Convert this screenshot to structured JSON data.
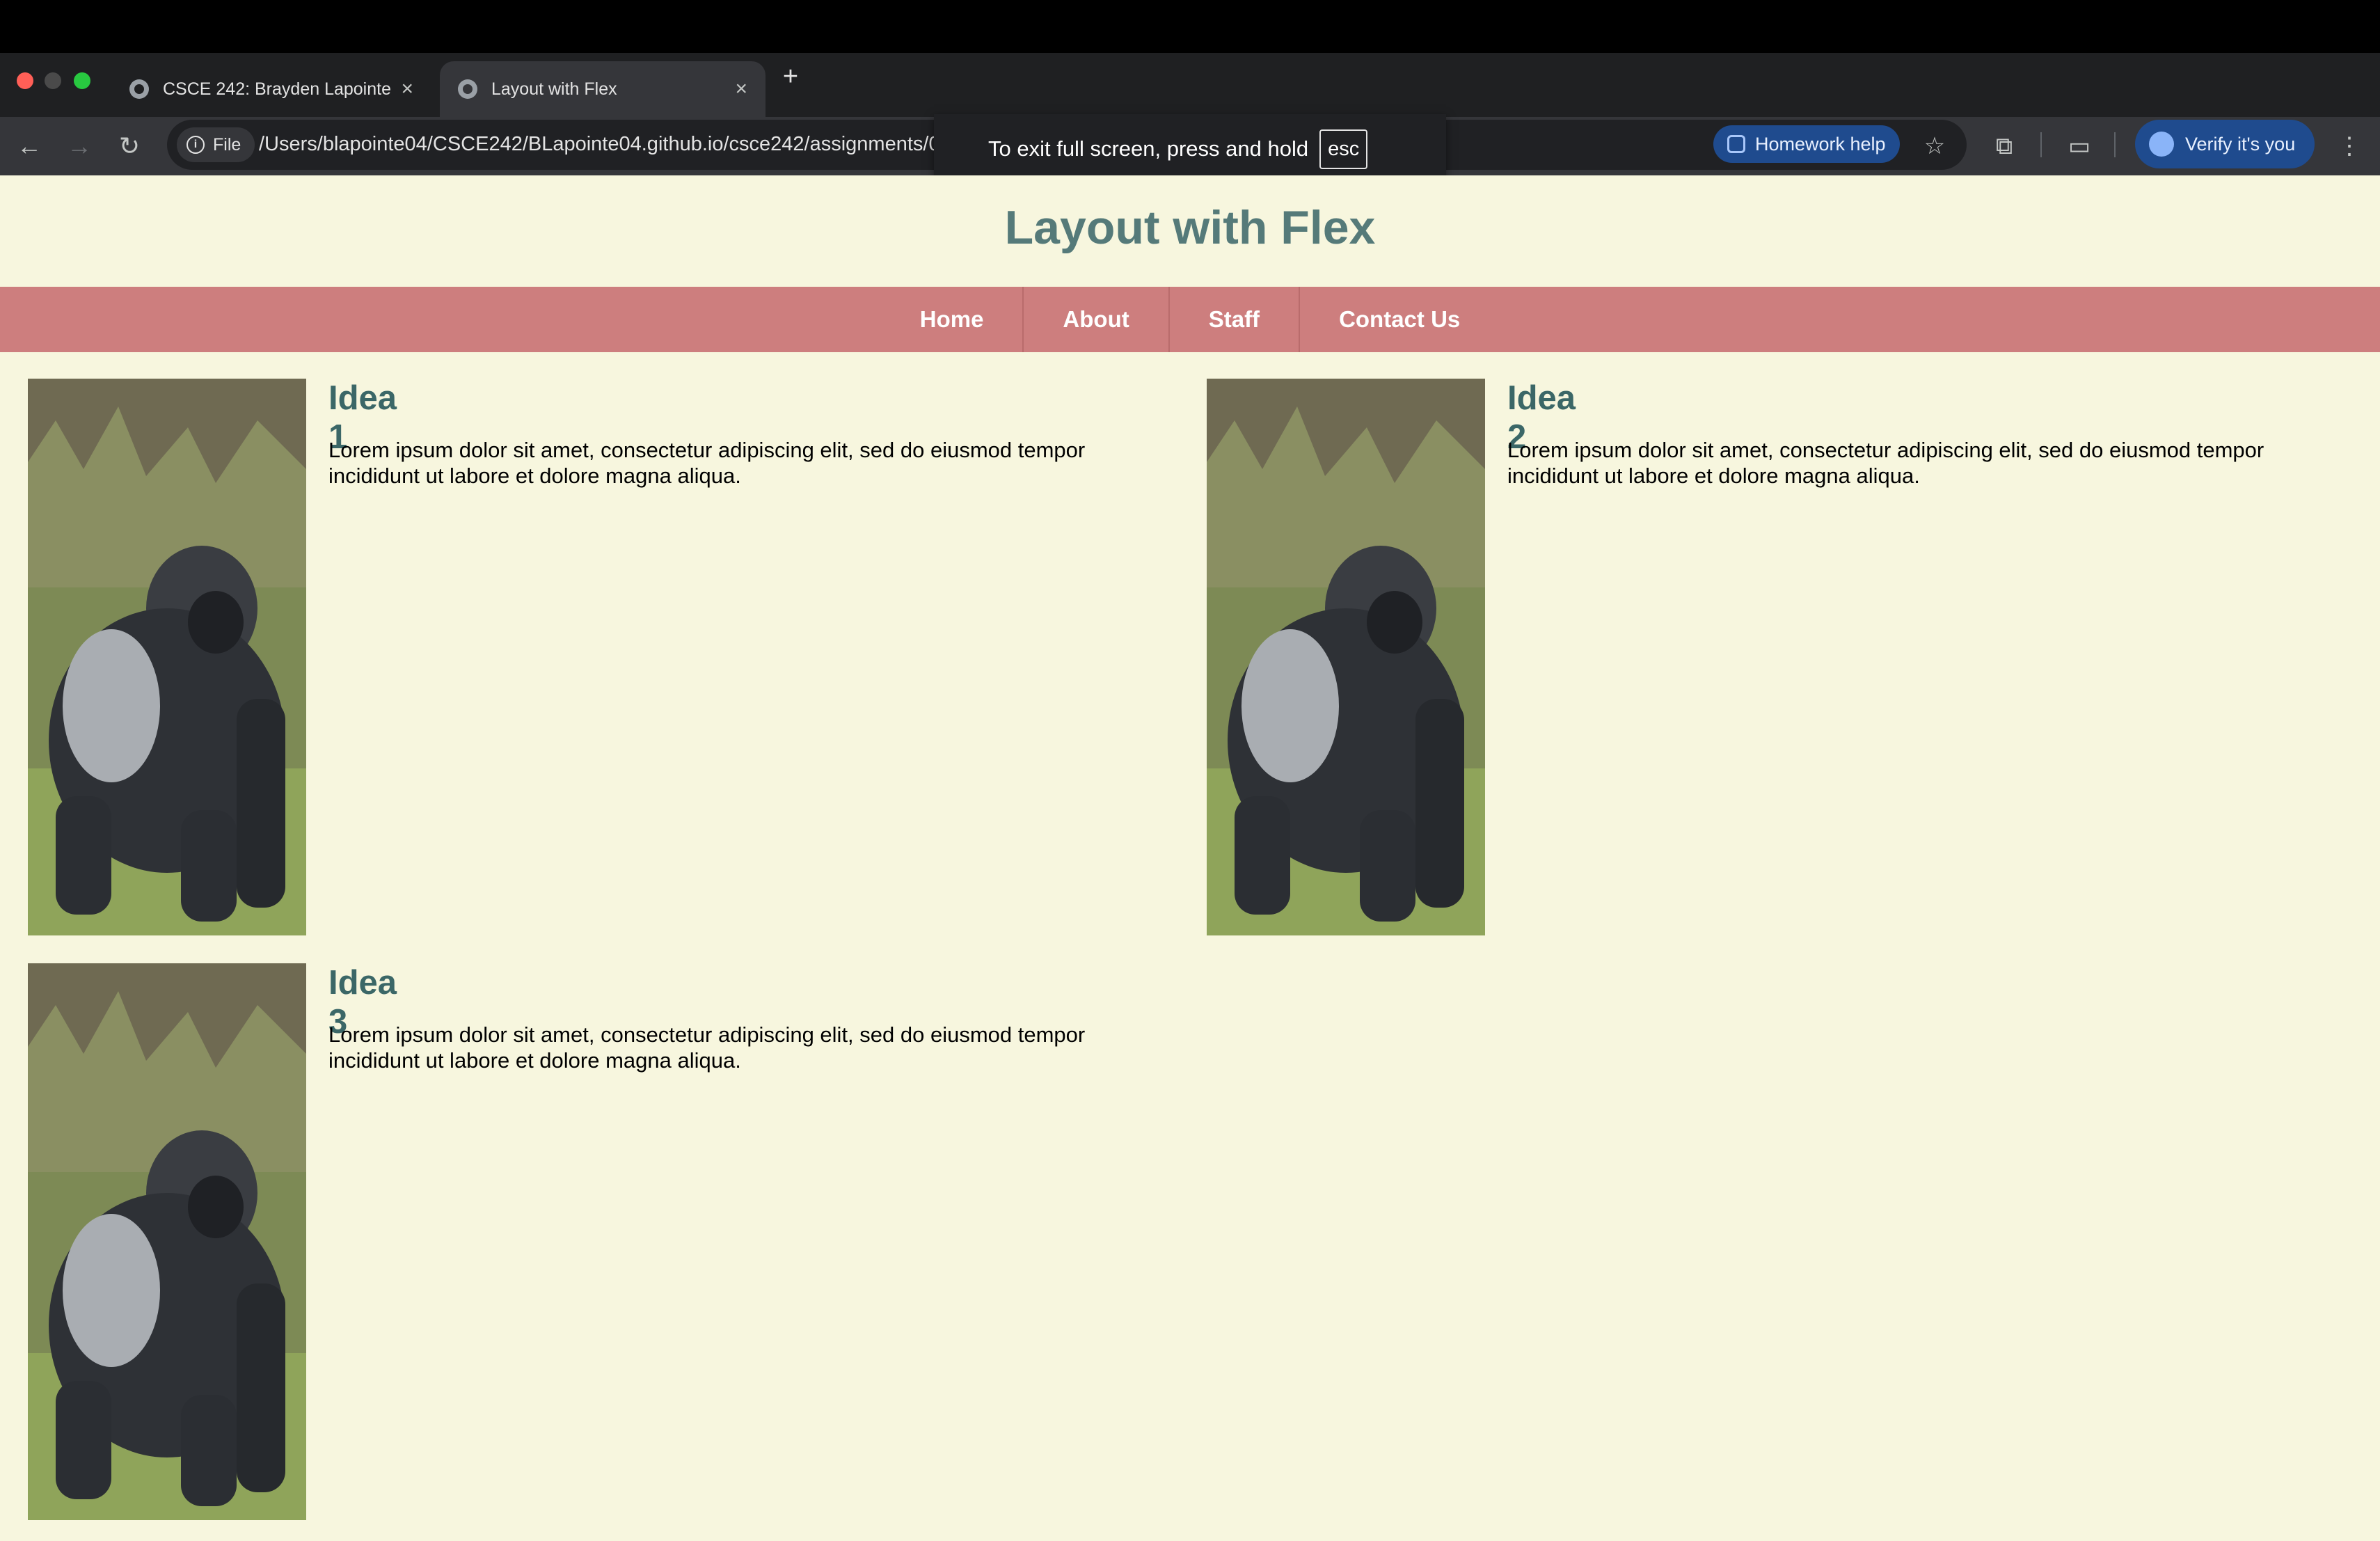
{
  "browser": {
    "tabs": [
      {
        "title": "CSCE 242: Brayden Lapointe",
        "active": false
      },
      {
        "title": "Layout with Flex",
        "active": true
      }
    ],
    "address": {
      "chip_label": "File",
      "url": "/Users/blapointe04/CSCE242/BLapointe04.github.io/csce242/assignments/03"
    },
    "homework_help_label": "Homework help",
    "verify_label": "Verify it's you",
    "fullscreen_toast": {
      "text": "To exit full screen, press and hold",
      "key": "esc"
    }
  },
  "page": {
    "title": "Layout with Flex",
    "nav": [
      "Home",
      "About",
      "Staff",
      "Contact Us"
    ],
    "ideas": [
      {
        "title": "Idea 1",
        "text": "Lorem ipsum dolor sit amet, consectetur adipiscing elit, sed do eiusmod tempor incididunt ut labore et dolore magna aliqua.",
        "image": "gorilla"
      },
      {
        "title": "Idea 2",
        "text": "Lorem ipsum dolor sit amet, consectetur adipiscing elit, sed do eiusmod tempor incididunt ut labore et dolore magna aliqua.",
        "image": "gorilla"
      },
      {
        "title": "Idea 3",
        "text": "Lorem ipsum dolor sit amet, consectetur adipiscing elit, sed do eiusmod tempor incididunt ut labore et dolore magna aliqua.",
        "image": "gorilla"
      }
    ]
  },
  "colors": {
    "page_background": "#f7f6de",
    "title": "#557a79",
    "nav_background": "#cd7e7e",
    "idea_heading": "#3b6767"
  }
}
